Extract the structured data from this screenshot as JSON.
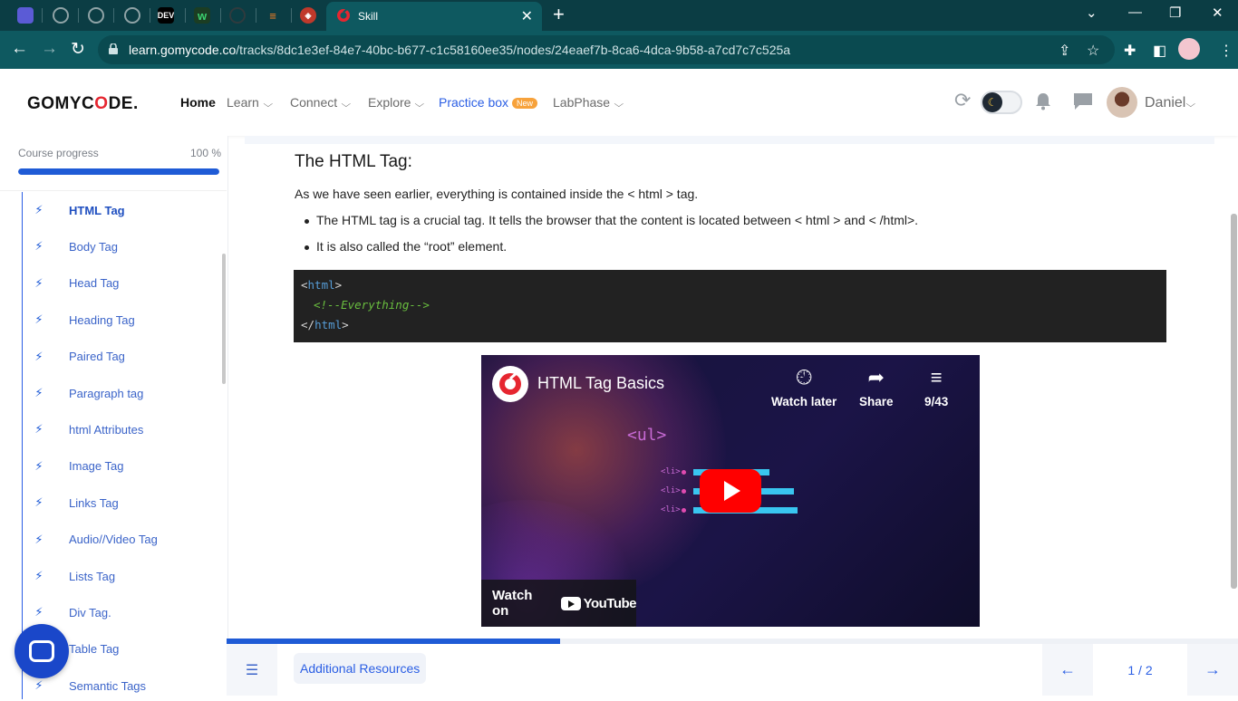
{
  "browser": {
    "pinned_tabs": [
      {
        "icon": "app-icon",
        "color": "#5b5bd6",
        "text": ""
      },
      {
        "icon": "globe-icon",
        "color": "#6d7f83",
        "text": ""
      },
      {
        "icon": "globe-icon",
        "color": "#6d7f83",
        "text": ""
      },
      {
        "icon": "globe-icon",
        "color": "#6d7f83",
        "text": ""
      },
      {
        "icon": "dev-icon",
        "color": "#000000",
        "text": "DEV"
      },
      {
        "icon": "w-icon",
        "color": "#1b3d23",
        "text": "w"
      },
      {
        "icon": "github-icon",
        "color": "#223033",
        "text": ""
      },
      {
        "icon": "stackoverflow-icon",
        "color": "#223033",
        "text": ""
      },
      {
        "icon": "hexagon-icon",
        "color": "#c0392b",
        "text": ""
      }
    ],
    "active_tab_title": "Skill",
    "url_host": "learn.gomycode.co",
    "url_path": "/tracks/8dc1e3ef-84e7-40bc-b677-c1c58160ee35/nodes/24eaef7b-8ca6-4dca-9b58-a7cd7c7c525a"
  },
  "header": {
    "logo_pre": "GOMYC",
    "logo_o": "O",
    "logo_post": "DE",
    "logo_mark": ".",
    "nav": {
      "home": "Home",
      "learn": "Learn",
      "connect": "Connect",
      "explore": "Explore",
      "practice": "Practice box",
      "practice_badge": "New",
      "labphase": "LabPhase"
    },
    "user_name": "Daniel",
    "dark_mode_on": true
  },
  "sidebar": {
    "progress_label": "Course progress",
    "progress_value": "100 %",
    "progress_fraction": 1.0,
    "lessons": [
      "HTML Tag",
      "Body Tag",
      "Head Tag",
      "Heading Tag",
      "Paired Tag",
      "Paragraph tag",
      "html Attributes",
      "Image Tag",
      "Links Tag",
      "Audio//Video Tag",
      "Lists Tag",
      "Div Tag.",
      "Table Tag",
      "Semantic Tags"
    ],
    "current_lesson": "HTML Tag"
  },
  "content": {
    "heading": "The HTML Tag:",
    "intro": "As we have seen earlier, everything is contained inside the < html > tag.",
    "bullets": [
      "The HTML tag is a crucial tag. It tells the browser that the content is located between < html > and < /html>.",
      "It is also called the “root” element."
    ],
    "code": {
      "open_lt": "<",
      "open_name": "html",
      "open_gt": ">",
      "comment": "<!--Everything-->",
      "close_lt": "</",
      "close_name": "html",
      "close_gt": ">"
    },
    "video": {
      "title": "HTML Tag Basics",
      "watch_later": "Watch later",
      "share": "Share",
      "playlist": "9/43",
      "ul_label": "<ul>",
      "li_label": "<li>",
      "watch_on": "Watch on",
      "youtube": "YouTube"
    }
  },
  "footer": {
    "progress_fraction": 0.33,
    "resources_label": "Additional Resources",
    "page_indicator": "1 / 2"
  },
  "colors": {
    "accent": "#2a5ee4",
    "brand_red": "#e62630",
    "browser_frame": "#0e5960"
  }
}
